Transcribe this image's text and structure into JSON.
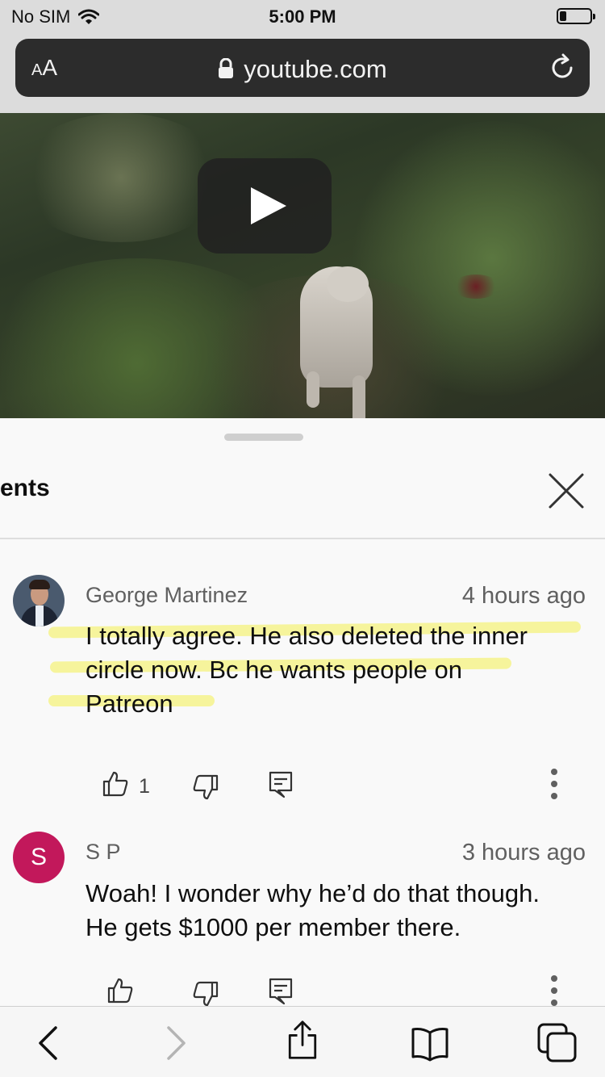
{
  "status_bar": {
    "carrier": "No SIM",
    "time": "5:00 PM"
  },
  "address_bar": {
    "text_size_small": "A",
    "text_size_large": "A",
    "domain": "youtube.com"
  },
  "panel": {
    "title": "ents"
  },
  "comments": [
    {
      "author": "George Martinez",
      "time": "4 hours ago",
      "lines": [
        "I totally agree. He also deleted the inner",
        "circle now. Bc he wants people on",
        "Patreon"
      ],
      "likes": "1"
    },
    {
      "author": "S P",
      "avatar_letter": "S",
      "time": "3 hours ago",
      "lines": [
        "Woah! I wonder why he’d do that though.",
        "He gets $1000 per member there."
      ]
    }
  ],
  "colors": {
    "highlight": "#f4f050",
    "avatar_sp": "#c2185b",
    "url_bar": "#2c2c2c"
  }
}
